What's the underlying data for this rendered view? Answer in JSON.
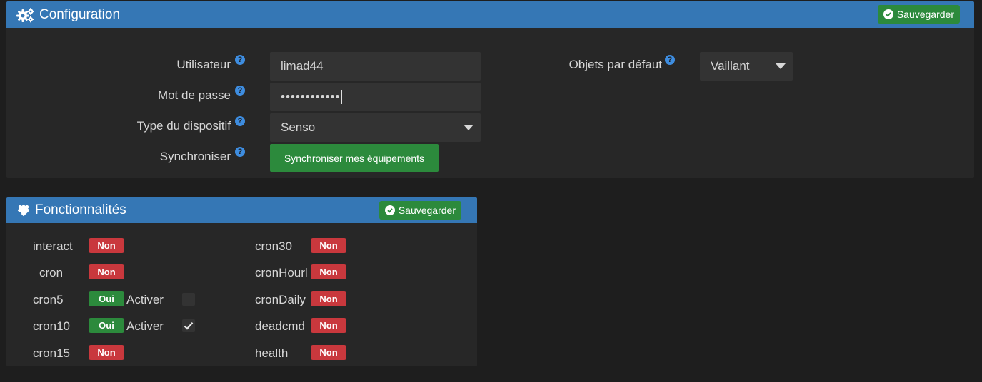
{
  "configuration": {
    "title": "Configuration",
    "save_label": "Sauvegarder",
    "fields": {
      "username": {
        "label": "Utilisateur",
        "value": "limad44"
      },
      "password": {
        "label": "Mot de passe",
        "value": "••••••••••••"
      },
      "device_type": {
        "label": "Type du dispositif",
        "value": "Senso"
      },
      "sync": {
        "label": "Synchroniser",
        "button_label": "Synchroniser mes équipements"
      },
      "default_objects": {
        "label": "Objets par défaut",
        "value": "Vaillant"
      }
    },
    "help_glyph": "?"
  },
  "features": {
    "title": "Fonctionnalités",
    "save_label": "Sauvegarder",
    "activer_label": "Activer",
    "left": [
      {
        "name": "interact",
        "status": "Non"
      },
      {
        "name": "cron",
        "status": "Non"
      },
      {
        "name": "cron5",
        "status": "Oui",
        "activer": false
      },
      {
        "name": "cron10",
        "status": "Oui",
        "activer": true
      },
      {
        "name": "cron15",
        "status": "Non"
      }
    ],
    "right": [
      {
        "name": "cron30",
        "status": "Non"
      },
      {
        "name": "cronHourl",
        "status": "Non"
      },
      {
        "name": "cronDaily",
        "status": "Non"
      },
      {
        "name": "deadcmd",
        "status": "Non"
      },
      {
        "name": "health",
        "status": "Non"
      }
    ]
  },
  "icons": {
    "config": "cogs-icon",
    "features": "puzzle-icon",
    "save": "check-circle-icon",
    "help": "question-circle-icon"
  },
  "colors": {
    "header": "#3577b5",
    "success": "#2c8a3c",
    "danger": "#c9383d",
    "panel": "#272727",
    "background": "#1e1e1e"
  }
}
